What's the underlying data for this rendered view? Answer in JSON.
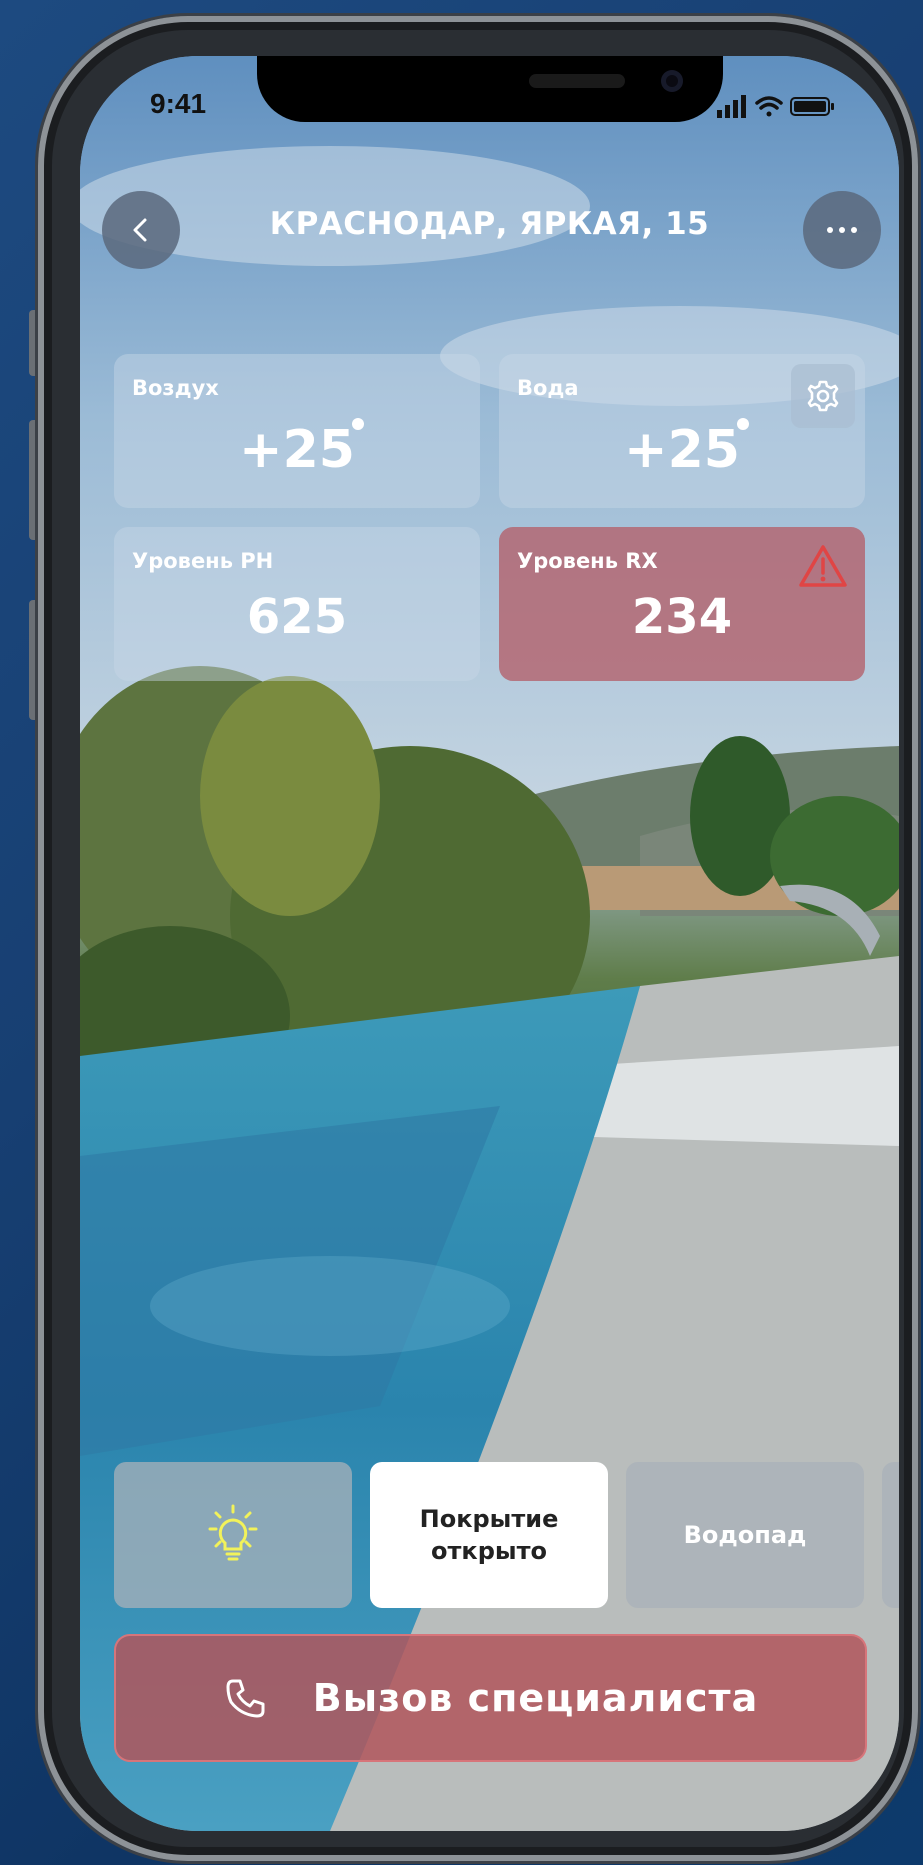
{
  "status_bar": {
    "time": "9:41"
  },
  "header": {
    "title": "КРАСНОДАР, ЯРКАЯ, 15"
  },
  "cards": {
    "air": {
      "label": "Воздух",
      "value": "+25"
    },
    "water": {
      "label": "Вода",
      "value": "+25"
    },
    "ph": {
      "label": "Уровень PH",
      "value": "625"
    },
    "rx": {
      "label": "Уровень RX",
      "value": "234"
    }
  },
  "controls": {
    "cover_label": "Покрытие открыто",
    "waterfall_label": "Водопад"
  },
  "call_button": {
    "label": "Вызов специалиста"
  },
  "icons": {
    "back": "chevron-left-icon",
    "more": "ellipsis-icon",
    "settings": "gear-icon",
    "warning": "warning-triangle-icon",
    "light": "light-bulb-icon",
    "phone": "phone-icon"
  },
  "colors": {
    "alert": "#b05a5f",
    "accent_white": "#ffffff"
  }
}
